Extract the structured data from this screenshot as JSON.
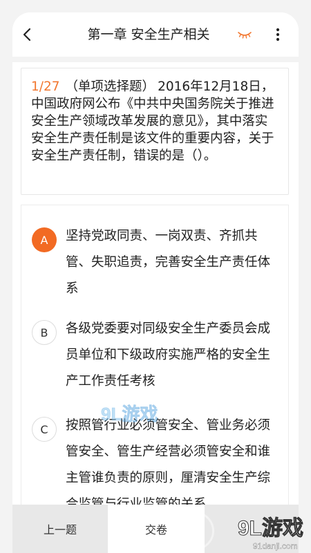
{
  "header": {
    "title": "第一章 安全生产相关",
    "back_icon": "chevron-left-icon",
    "eye_icon": "eye-closed-icon",
    "more_icon": "more-vertical-icon"
  },
  "question": {
    "index": "1/27",
    "type": "（单项选择题）",
    "text": "2016年12月18日，中国政府网公布《中共中央国务院关于推进安全生产领域改革发展的意见》，其中落实安全生产责任制是该文件的重要内容，关于安全生产责任制，错误的是（）。"
  },
  "options": [
    {
      "letter": "A",
      "text": "坚持党政同责、一岗双责、齐抓共管、失职追责，完善安全生产责任体系",
      "selected": true
    },
    {
      "letter": "B",
      "text": "各级党委要对同级安全生产委员会成员单位和下级政府实施严格的安全生产工作责任考核",
      "selected": false
    },
    {
      "letter": "C",
      "text": "按照管行业必须管安全、管业务必须管安全、管生产经营必须管安全和谁主管谁负责的原则，厘清安全生产综合监管与行业监管的关系",
      "selected": false
    }
  ],
  "bottom_bar": {
    "prev_label": "上一题",
    "submit_label": "交卷"
  },
  "watermark": {
    "center_text": "9L游戏",
    "logo_text": "9L游戏",
    "site_text": "91danji.com"
  },
  "colors": {
    "accent": "#f26a23",
    "index_color": "#f2772f"
  }
}
